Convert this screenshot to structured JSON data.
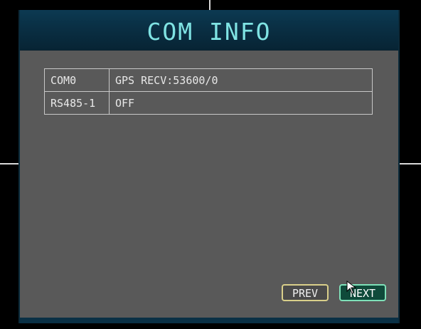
{
  "window": {
    "title": "COM INFO"
  },
  "ports": [
    {
      "port": "COM0",
      "value": "GPS RECV:53600/0"
    },
    {
      "port": "RS485-1",
      "value": "OFF"
    }
  ],
  "buttons": {
    "prev_label": "PREV",
    "next_label": "NEXT"
  },
  "colors": {
    "title_text": "#7fe3e3",
    "titlebar_bg": "#0a3045",
    "panel_bg": "#595959",
    "prev_border": "#d9cf8a",
    "next_border": "#7ee0b8"
  },
  "icons": {
    "cursor": "mouse-pointer-icon"
  }
}
